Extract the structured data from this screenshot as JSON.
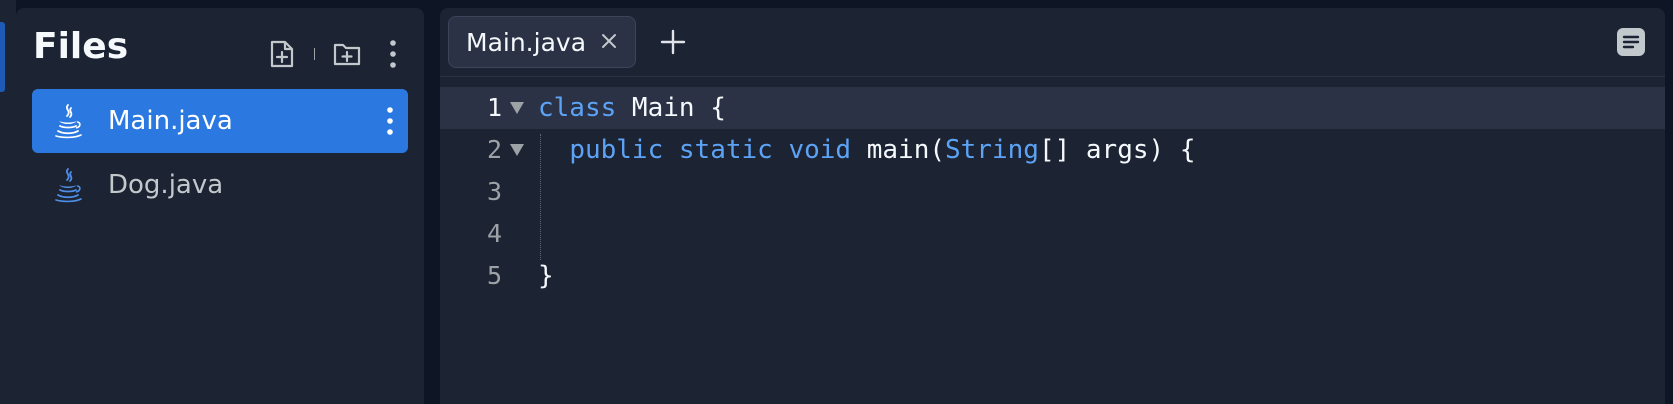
{
  "files_panel": {
    "title": "Files",
    "actions": {
      "new_file_icon": "file-plus-icon",
      "new_folder_icon": "folder-plus-icon",
      "more_icon": "kebab-icon"
    },
    "files": [
      {
        "name": "Main.java",
        "icon": "java-icon",
        "selected": true
      },
      {
        "name": "Dog.java",
        "icon": "java-icon",
        "selected": false
      }
    ]
  },
  "editor": {
    "tabs": [
      {
        "label": "Main.java",
        "active": true
      }
    ],
    "add_tab_icon": "plus-icon",
    "menu_icon": "list-icon",
    "lines": [
      {
        "number": "1",
        "foldable": true
      },
      {
        "number": "2",
        "foldable": true
      },
      {
        "number": "3",
        "foldable": false
      },
      {
        "number": "4",
        "foldable": false
      },
      {
        "number": "5",
        "foldable": false
      }
    ],
    "code": {
      "line1": {
        "kw": "class",
        "rest": " Main {"
      },
      "line2": {
        "kw1": "public",
        "kw2": "static",
        "kw3": "void",
        "name": " main(",
        "type": "String",
        "rest": "[] args) {"
      },
      "line5": "}"
    }
  },
  "colors": {
    "accent": "#2b79e0",
    "keyword": "#5ca3f5",
    "background": "#0e1525",
    "panel": "#1c2333"
  }
}
